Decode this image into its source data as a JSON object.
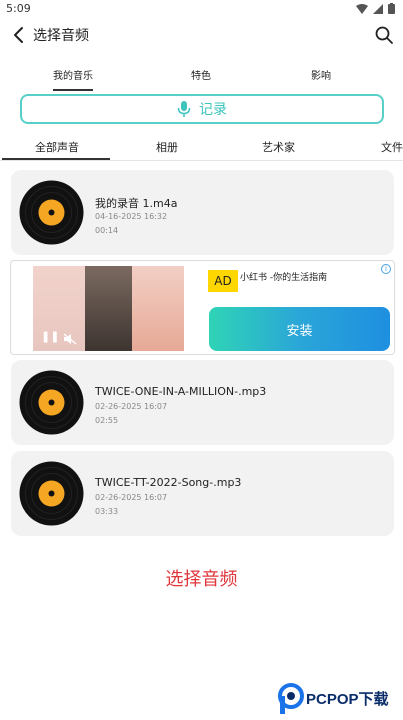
{
  "status_bar": {
    "time": "5:09"
  },
  "header": {
    "title": "选择音频"
  },
  "top_tabs": [
    {
      "label": "我的音乐",
      "active": true
    },
    {
      "label": "特色",
      "active": false
    },
    {
      "label": "影响",
      "active": false
    }
  ],
  "record_button": {
    "label": "记录"
  },
  "category_tabs": [
    {
      "label": "全部声音",
      "active": true
    },
    {
      "label": "相册",
      "active": false
    },
    {
      "label": "艺术家",
      "active": false
    },
    {
      "label": "文件",
      "active": false
    }
  ],
  "audio_items": [
    {
      "name": "我的录音 1.m4a",
      "date": "04-16-2025 16:32",
      "duration": "00:14"
    },
    {
      "name": "TWICE-ONE-IN-A-MILLION-.mp3",
      "date": "02-26-2025 16:07",
      "duration": "02:55"
    },
    {
      "name": "TWICE-TT-2022-Song-.mp3",
      "date": "02-26-2025 16:07",
      "duration": "03:33"
    }
  ],
  "ad": {
    "badge": "AD",
    "title": "小红书 -你的生活指南",
    "install_label": "安装"
  },
  "select_audio_label": "选择音频",
  "watermark": {
    "text": "PCPOP下载"
  },
  "colors": {
    "accent_teal": "#3ec4bd",
    "action_red": "#e0363b",
    "disc_orange": "#f5a623",
    "card_bg": "#f2f2f2"
  }
}
